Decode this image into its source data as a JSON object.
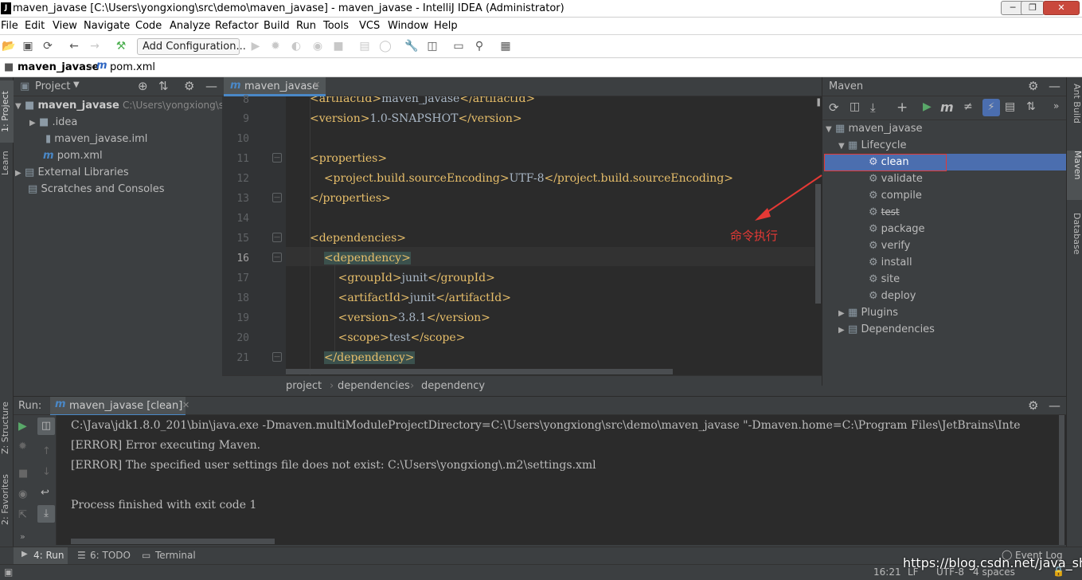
{
  "window": {
    "title": "maven_javase [C:\\Users\\yongxiong\\src\\demo\\maven_javase] - maven_javase - IntelliJ IDEA (Administrator)",
    "logo": "J"
  },
  "menu": [
    "File",
    "Edit",
    "View",
    "Navigate",
    "Code",
    "Analyze",
    "Refactor",
    "Build",
    "Run",
    "Tools",
    "VCS",
    "Window",
    "Help"
  ],
  "toolbar": {
    "add_configuration": "Add Configuration..."
  },
  "breadcrumb": {
    "project": "maven_javase",
    "file": "pom.xml"
  },
  "left_strip": {
    "project_tab": "1: Project",
    "learn_tab": "Learn",
    "structure_tab": "Z: Structure",
    "favorites_tab": "2: Favorites"
  },
  "right_strip": {
    "ant_tab": "Ant Build",
    "maven_tab": "Maven",
    "database_tab": "Database"
  },
  "project_panel": {
    "title": "Project",
    "tree": [
      {
        "label": "maven_javase",
        "path": "C:\\Users\\yongxiong\\src\\"
      },
      {
        "label": ".idea"
      },
      {
        "label": "maven_javase.iml"
      },
      {
        "label": "pom.xml"
      },
      {
        "label": "External Libraries"
      },
      {
        "label": "Scratches and Consoles"
      }
    ]
  },
  "editor": {
    "tab": "maven_javase",
    "line_numbers": [
      "8",
      "9",
      "10",
      "11",
      "12",
      "13",
      "14",
      "15",
      "16",
      "17",
      "18",
      "19",
      "20",
      "21"
    ],
    "lines": [
      {
        "indent": "",
        "pre": "<artifactId>",
        "text": "maven_javase",
        "post": "</artifactId>"
      },
      {
        "indent": "",
        "pre": "<version>",
        "text": "1.0-SNAPSHOT",
        "post": "</version>"
      },
      {
        "indent": "",
        "pre": "",
        "text": "",
        "post": ""
      },
      {
        "indent": "",
        "pre": "<properties>",
        "text": "",
        "post": ""
      },
      {
        "indent": "    ",
        "pre": "<project.build.sourceEncoding>",
        "text": "UTF-8",
        "post": "</project.build.sourceEncoding>"
      },
      {
        "indent": "",
        "pre": "</properties>",
        "text": "",
        "post": ""
      },
      {
        "indent": "",
        "pre": "",
        "text": "",
        "post": ""
      },
      {
        "indent": "",
        "pre": "<dependencies>",
        "text": "",
        "post": ""
      },
      {
        "indent": "    ",
        "pre": "<dependency>",
        "text": "",
        "post": ""
      },
      {
        "indent": "        ",
        "pre": "<groupId>",
        "text": "junit",
        "post": "</groupId>"
      },
      {
        "indent": "        ",
        "pre": "<artifactId>",
        "text": "junit",
        "post": "</artifactId>"
      },
      {
        "indent": "        ",
        "pre": "<version>",
        "text": "3.8.1",
        "post": "</version>"
      },
      {
        "indent": "        ",
        "pre": "<scope>",
        "text": "test",
        "post": "</scope>"
      },
      {
        "indent": "    ",
        "pre": "</dependency>",
        "text": "",
        "post": ""
      }
    ],
    "breadcrumbs": [
      "project",
      "dependencies",
      "dependency"
    ]
  },
  "maven": {
    "title": "Maven",
    "project": "maven_javase",
    "lifecycle": "Lifecycle",
    "goals": [
      "clean",
      "validate",
      "compile",
      "test",
      "package",
      "verify",
      "install",
      "site",
      "deploy"
    ],
    "plugins": "Plugins",
    "dependencies": "Dependencies",
    "annotation": "命令执行"
  },
  "run": {
    "label": "Run:",
    "tab": "maven_javase [clean]",
    "output": [
      "C:\\Java\\jdk1.8.0_201\\bin\\java.exe -Dmaven.multiModuleProjectDirectory=C:\\Users\\yongxiong\\src\\demo\\maven_javase \"-Dmaven.home=C:\\Program Files\\JetBrains\\Inte",
      "[ERROR] Error executing Maven.",
      "[ERROR] The specified user settings file does not exist: C:\\Users\\yongxiong\\.m2\\settings.xml",
      "",
      "Process finished with exit code 1"
    ]
  },
  "bottom_tabs": {
    "run": "4: Run",
    "todo": "6: TODO",
    "terminal": "Terminal",
    "event_log": "Event Log"
  },
  "status": {
    "position": "16:21",
    "line_sep": "LF",
    "encoding": "UTF-8",
    "indent": "4 spaces",
    "watermark": "https://blog.csdn.net/java_shm"
  },
  "colors": {
    "highlight": "#4b6eaf",
    "annotation": "#e53935",
    "tag": "#e8bf6a"
  }
}
